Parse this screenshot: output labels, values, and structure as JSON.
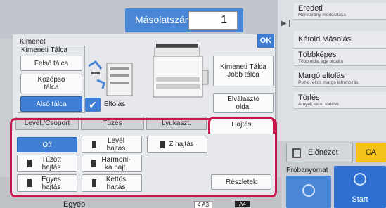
{
  "header": {
    "copies_label": "Másolatszám",
    "copies_value": "1"
  },
  "right_panel": {
    "items": [
      {
        "title": "Eredeti",
        "sub": "Méret/irány módosítása"
      },
      {
        "title": "Kétold.Másolás",
        "sub": ""
      },
      {
        "title": "Többképes",
        "sub": "Több oldal egy oldalra"
      },
      {
        "title": "Margó eltolás",
        "sub": "Pozíc. eltol. margó létrehozás"
      },
      {
        "title": "Törlés",
        "sub": "Árnyék keret törlése"
      }
    ],
    "preview_label": "Előnézet",
    "ca_label": "CA",
    "proba_label": "Próbanyomat",
    "start_label": "Start"
  },
  "bottom": {
    "egyeb_label": "Egyéb",
    "paper_label": "4   A3",
    "paper_a4": "A4"
  },
  "dialog": {
    "title": "Kimenet",
    "ok_label": "OK",
    "tray_group_label": "Kimeneti Tálca",
    "trays": [
      "Felső tálca",
      "Középso tálca",
      "Alsó tálca"
    ],
    "selected_tray": "Alsó tálca",
    "right_tray_label": "Kimeneti Tálca Jobb tálca",
    "eltolas_label": "Eltolás",
    "separator_label": "Elválasztó oldal",
    "tabs": [
      "Levél./Csoport",
      "Tűzés",
      "Lyukaszt.",
      "Hajtás"
    ],
    "active_tab": "Hajtás",
    "fold_options": {
      "off": "Off",
      "letter": "Levél hajtás",
      "z": "Z hajtás",
      "gate": "Tűzött hajtás",
      "accordion": "Harmoni-ka hajt.",
      "single": "Egyes hajtás",
      "double": "Kettős hajtás"
    },
    "details_label": "Részletek"
  }
}
